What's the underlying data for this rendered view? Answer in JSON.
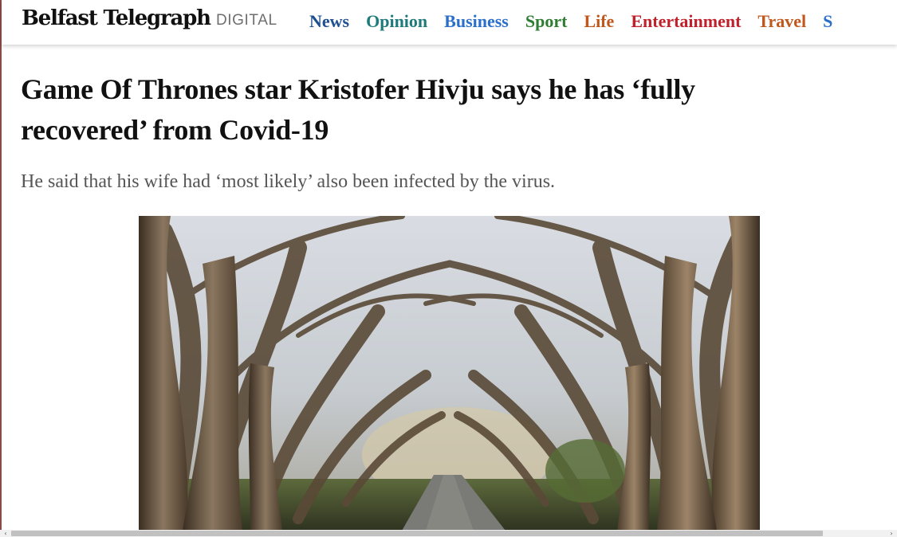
{
  "header": {
    "logo_name": "Belfast Telegraph",
    "logo_sub": "DIGITAL",
    "nav": [
      {
        "label": "News",
        "color": "#1d4f91"
      },
      {
        "label": "Opinion",
        "color": "#1e7b7b"
      },
      {
        "label": "Business",
        "color": "#2a6fc9"
      },
      {
        "label": "Sport",
        "color": "#2e7d32"
      },
      {
        "label": "Life",
        "color": "#c0571d"
      },
      {
        "label": "Entertainment",
        "color": "#c0202b"
      },
      {
        "label": "Travel",
        "color": "#c0571d"
      },
      {
        "label": "S",
        "color": "#2a6fc9"
      }
    ]
  },
  "article": {
    "headline": "Game Of Thrones star Kristofer Hivju says he has ‘fully recovered’ from Covid-19",
    "standfirst": "He said that his wife had ‘most likely’ also been infected by the virus."
  },
  "scrollbar": {
    "left_arrow": "‹",
    "right_arrow": "›"
  }
}
